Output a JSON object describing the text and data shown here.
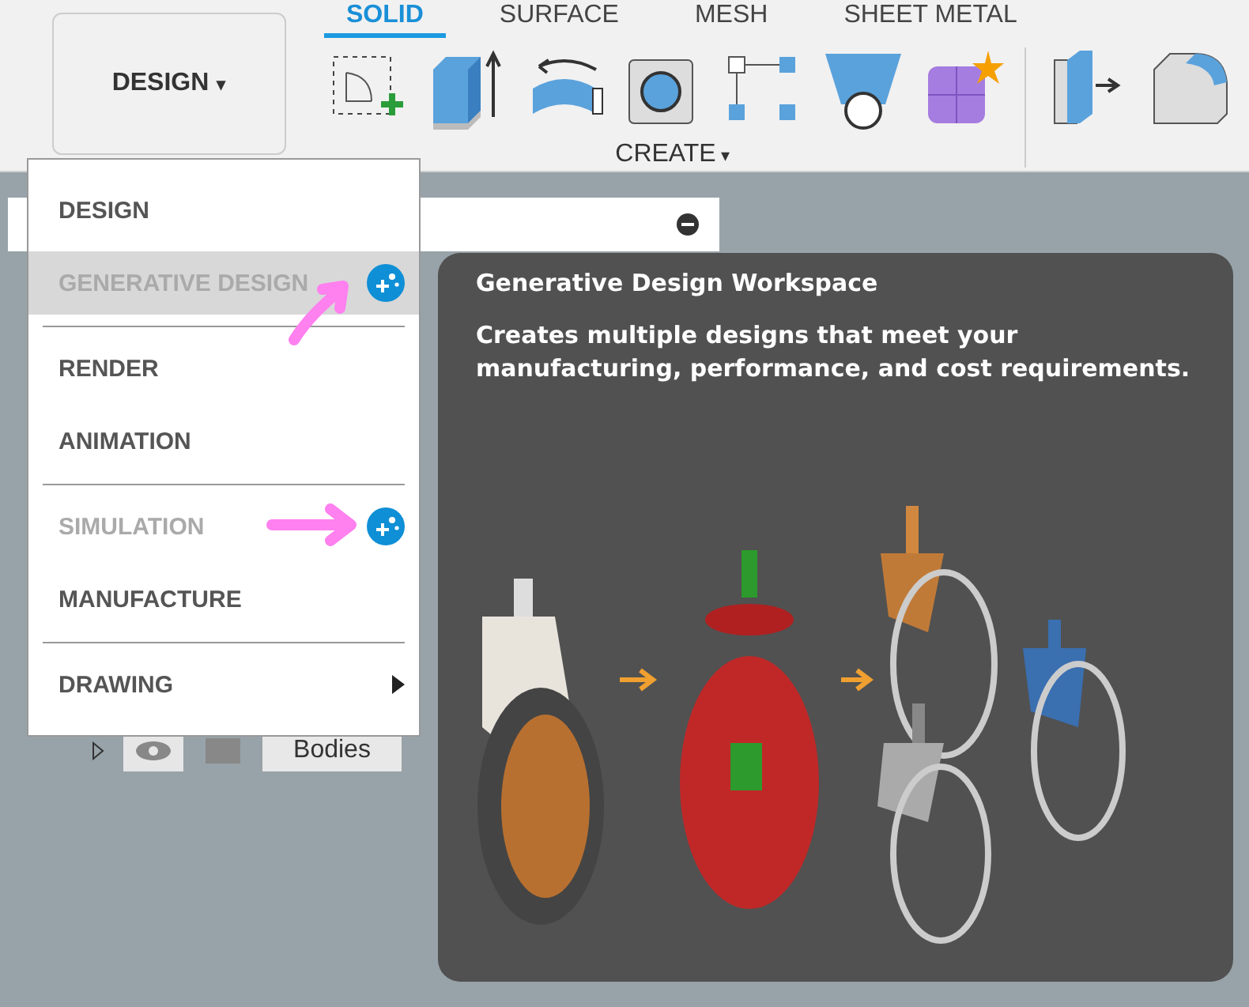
{
  "workspace_button": {
    "label": "DESIGN",
    "caret": "▾"
  },
  "tabs": [
    {
      "label": "SOLID",
      "selected": true
    },
    {
      "label": "SURFACE",
      "selected": false
    },
    {
      "label": "MESH",
      "selected": false
    },
    {
      "label": "SHEET METAL",
      "selected": false
    }
  ],
  "tool_group": {
    "label": "CREATE",
    "caret": "▾"
  },
  "browser": {
    "row_label": "Bodies",
    "visible": true
  },
  "workspace_menu": {
    "items": [
      {
        "label": "DESIGN",
        "disabled": false,
        "selected": false,
        "badge": false,
        "annotated": false,
        "submenu": false,
        "divider_after": false
      },
      {
        "label": "GENERATIVE DESIGN",
        "disabled": true,
        "selected": true,
        "badge": true,
        "annotated": true,
        "submenu": false,
        "divider_after": true
      },
      {
        "label": "RENDER",
        "disabled": false,
        "selected": false,
        "badge": false,
        "annotated": false,
        "submenu": false,
        "divider_after": false
      },
      {
        "label": "ANIMATION",
        "disabled": false,
        "selected": false,
        "badge": false,
        "annotated": false,
        "submenu": false,
        "divider_after": true
      },
      {
        "label": "SIMULATION",
        "disabled": true,
        "selected": false,
        "badge": true,
        "annotated": true,
        "submenu": false,
        "divider_after": false
      },
      {
        "label": "MANUFACTURE",
        "disabled": false,
        "selected": false,
        "badge": false,
        "annotated": false,
        "submenu": false,
        "divider_after": true
      },
      {
        "label": "DRAWING",
        "disabled": false,
        "selected": false,
        "badge": false,
        "annotated": false,
        "submenu": true,
        "divider_after": false
      }
    ]
  },
  "tooltip": {
    "title": "Generative Design Workspace",
    "description": "Creates multiple designs that meet your manufacturing, performance, and cost requirements."
  }
}
